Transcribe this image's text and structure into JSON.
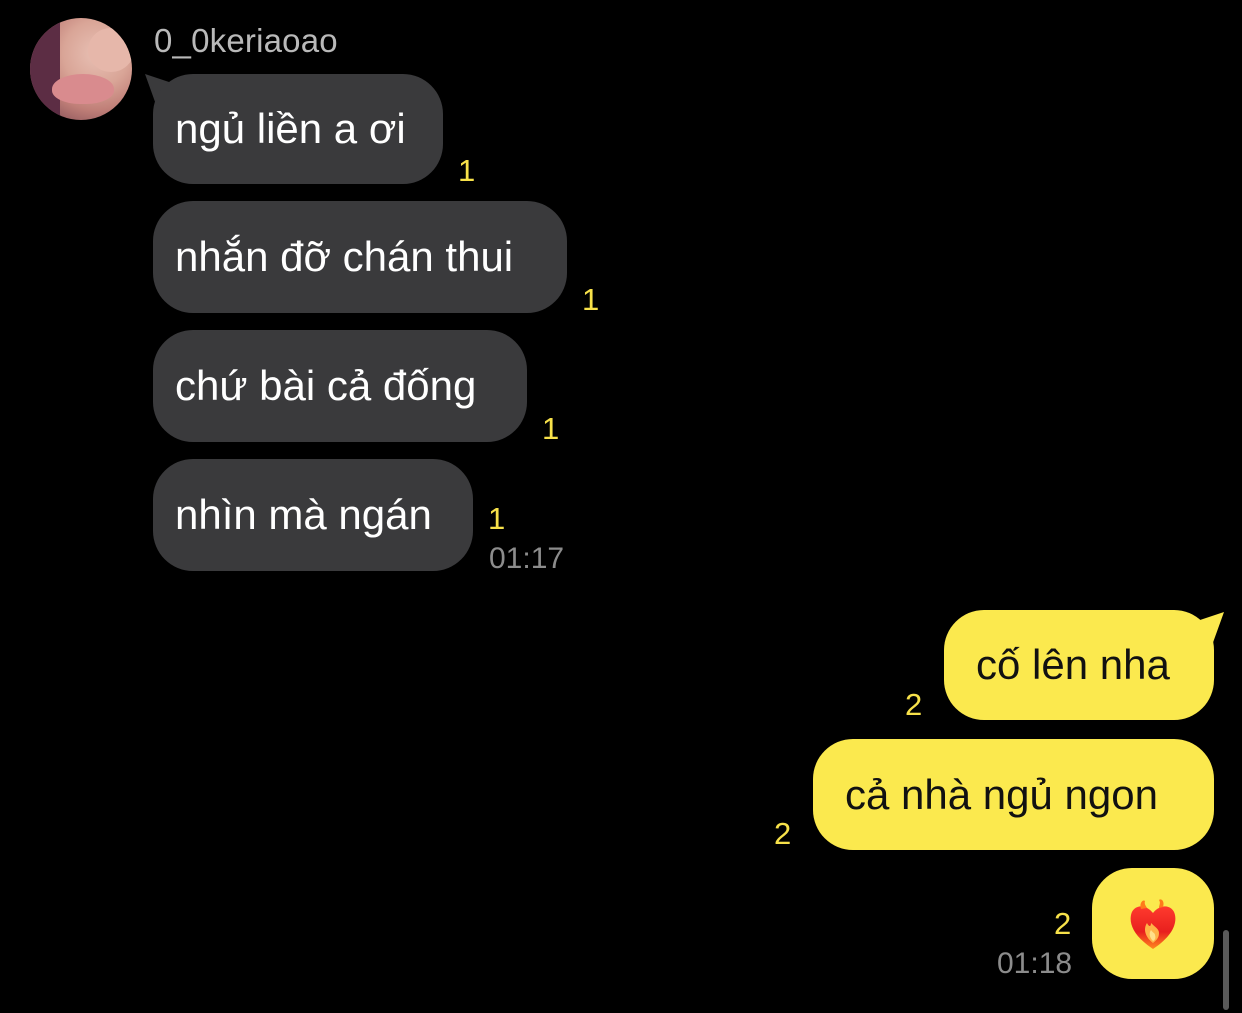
{
  "sender": {
    "name": "0_0keriaoao"
  },
  "incoming": [
    {
      "text": "ngủ liền a ơi",
      "unread": "1"
    },
    {
      "text": "nhắn đỡ chán thui",
      "unread": "1"
    },
    {
      "text": "chứ bài cả đống",
      "unread": "1"
    },
    {
      "text": "nhìn mà ngán",
      "unread": "1"
    }
  ],
  "incoming_time": "01:17",
  "outgoing": [
    {
      "text": "cố lên nha",
      "unread": "2"
    },
    {
      "text": "cả nhà ngủ ngon",
      "unread": "2"
    },
    {
      "emoji": "heart-on-fire-icon",
      "unread": "2"
    }
  ],
  "outgoing_time": "01:18",
  "colors": {
    "background": "#000000",
    "incoming_bubble": "#3a3a3c",
    "outgoing_bubble": "#fbe94e",
    "unread_count": "#f7e14a",
    "timestamp": "#8c8c8c",
    "username": "#b9b9b9"
  }
}
